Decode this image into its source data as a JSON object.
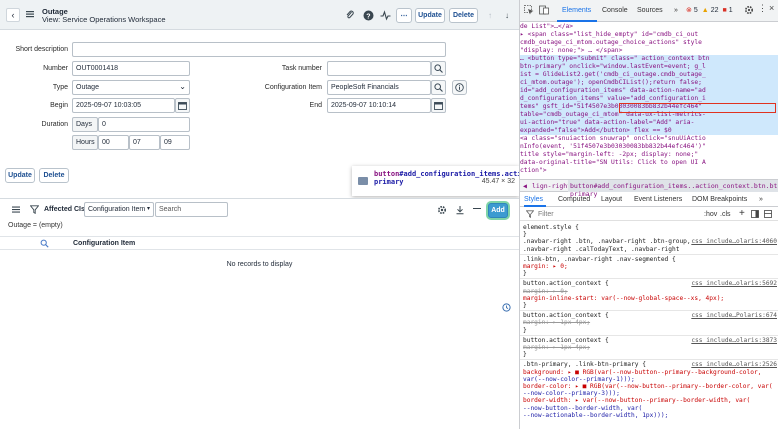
{
  "header": {
    "title": "Outage",
    "subtitle": "View: Service Operations Workspace",
    "update_label": "Update",
    "delete_label": "Delete"
  },
  "form": {
    "short_description_label": "Short description",
    "short_description_value": "",
    "number_label": "Number",
    "number_value": "OUT0001418",
    "type_label": "Type",
    "type_value": "Outage",
    "begin_label": "Begin",
    "begin_value": "2025-09-07 10:03:05",
    "duration_label": "Duration",
    "days_label": "Days",
    "days_value": "0",
    "hours_label": "Hours",
    "hours_value": "00",
    "minutes_value": "07",
    "seconds_value": "09",
    "task_number_label": "Task number",
    "task_number_value": "",
    "config_item_label": "Configuration Item",
    "config_item_value": "PeopleSoft Financials",
    "end_label": "End",
    "end_value": "2025-09-07 10:10:14"
  },
  "bottom_buttons": {
    "update_label": "Update",
    "delete_label": "Delete"
  },
  "tooltip": {
    "element_tag": "button",
    "element_rest": "#add_configuration_items.action_context.btn.btn-primary",
    "dimensions": "45.47 × 32"
  },
  "related_list": {
    "title": "Affected CIs",
    "filter_select_value": "Configuration Item",
    "search_placeholder": "Search",
    "add_label": "Add",
    "filter_text": "Outage = (empty)",
    "column_header": "Configuration Item",
    "empty_text": "No records to display"
  },
  "devtools": {
    "tabs": [
      "Elements",
      "Console",
      "Sources"
    ],
    "error_count": "5",
    "warning_count": "22",
    "info_count": "1",
    "elements_lines": [
      "  de List\">…</a>",
      "▸ <span class=\"list_hide_empty\" id=\"cmdb_ci_out",
      "   cmdb_outage_ci_mtom.outage_choice_actions\" style",
      "   \"display: none;\"> … </span>",
      "…  <button type=\"submit\" class=\" action_context btn",
      "   btn-primary\" onclick=\"window.lastEvent=event; g_l",
      "   ist = GlideList2.get('cmdb_ci_outage.cmdb_outage_",
      "   ci_mtom.outage'); openCmdbCIList();return false;",
      "   id=\"add_configuration_items\" data-action-name=\"ad",
      "   d_configuration_items\" value=\"add_configuration_i",
      "   tems\" gsft_id=\"51f4507e3b03030083bb832b44efc464\"",
      "   table=\"cmdb_outage_ci_mtom\" data-ux-list-metrics-",
      "   ui-action=\"true\" data-action-label=\"Add\" aria-",
      "   expanded=\"false\">Add</button> flex == $0",
      "  <a class=\"snuiaction snuwrap\" onclick=\"snuUiActio",
      "   nInfo(event, '51f4507e3b03030083bb832b44efc464')\"",
      "   title style=\"margin-left: -2px; display: none;\"",
      "   data-original-title=\"SN Utils: Click to open UI A",
      "   ction\">"
    ],
    "breadcrumb_left": "lign-right",
    "breadcrumb_right": "button#add_configuration_items..action_context.btn.btn-primary",
    "sub_tabs": [
      "Styles",
      "Computed",
      "Layout",
      "Event Listeners",
      "DOM Breakpoints"
    ],
    "filter_placeholder": "Filter",
    "hov_label": ":hov",
    "cls_label": ".cls",
    "styles_lines": [
      {
        "text": "element.style {",
        "src": ""
      },
      {
        "text": "}",
        "src": ""
      },
      {
        "text": ".navbar-right .btn, .navbar-right .btn-group,",
        "src": "css_include…olaris:4060"
      },
      {
        "text": ".navbar-right .calTodayText, .navbar-right",
        "src": ""
      },
      {
        "text": ".link-btn, .navbar-right .nav-segmented {",
        "src": ""
      },
      {
        "text": "  margin: ▸ 0;",
        "src": ""
      },
      {
        "text": "}",
        "src": ""
      },
      {
        "text": "button.action_context {",
        "src": "css_include…olaris:5692"
      },
      {
        "text": "  margin: ▸ 0;",
        "src": "",
        "strike": true
      },
      {
        "text": "  margin-inline-start: var(--now-global-space--xs, 4px);",
        "src": ""
      },
      {
        "text": "}",
        "src": ""
      },
      {
        "text": "button.action_context {",
        "src": "css_include…Polaris:674"
      },
      {
        "text": "  margin: ▸ 1px 4px;",
        "src": "",
        "strike": true
      },
      {
        "text": "}",
        "src": ""
      },
      {
        "text": "button.action_context {",
        "src": "css_include…olaris:3873"
      },
      {
        "text": "  margin: ▸ 1px 4px;",
        "src": "",
        "strike": true
      },
      {
        "text": "}",
        "src": ""
      },
      {
        "text": ".btn-primary, .link-btn-primary {",
        "src": "css_include…olaris:2526"
      },
      {
        "text": "  background: ▸ ■ RGB(var(--now-button--primary--background-color,",
        "src": ""
      },
      {
        "text": "      var(--now-color--primary-1)));",
        "src": ""
      },
      {
        "text": "  border-color: ▸ ■ RGB(var(--now-button--primary--border-color, var(",
        "src": ""
      },
      {
        "text": "      --now-color--primary-3)));",
        "src": ""
      },
      {
        "text": "  border-width: ▸ var(--now-button--primary--border-width, var(",
        "src": ""
      },
      {
        "text": "      --now-button--border-width, var(",
        "src": ""
      },
      {
        "text": "      --now-actionable--border-width, 1px)));",
        "src": ""
      }
    ]
  },
  "colors": {
    "accent": "#1a73e8",
    "primary_button": "#3c9bd1",
    "highlight_border": "#e0321f"
  }
}
